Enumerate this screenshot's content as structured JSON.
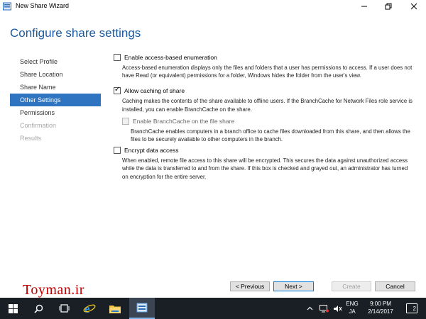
{
  "window": {
    "title": "New Share Wizard",
    "controls": {
      "minimize": "—",
      "maximize": "❐",
      "close": "✕"
    }
  },
  "page_title": "Configure share settings",
  "steps": [
    {
      "label": "Select Profile",
      "state": "normal"
    },
    {
      "label": "Share Location",
      "state": "normal"
    },
    {
      "label": "Share Name",
      "state": "normal"
    },
    {
      "label": "Other Settings",
      "state": "active"
    },
    {
      "label": "Permissions",
      "state": "normal"
    },
    {
      "label": "Confirmation",
      "state": "disabled"
    },
    {
      "label": "Results",
      "state": "disabled"
    }
  ],
  "options": {
    "abe": {
      "label": "Enable access-based enumeration",
      "checked": false,
      "description": "Access-based enumeration displays only the files and folders that a user has permissions to access. If a user does not have Read (or equivalent) permissions for a folder, Windows hides the folder from the user's view."
    },
    "caching": {
      "label": "Allow caching of share",
      "checked": true,
      "description": "Caching makes the contents of the share available to offline users. If the BranchCache for Network Files role service is installed, you can enable BranchCache on the share."
    },
    "branchcache": {
      "label": "Enable BranchCache on the file share",
      "checked": false,
      "disabled": true,
      "description": "BranchCache enables computers in a branch office to cache files downloaded from this share, and then allows the files to be securely available to other computers in the branch."
    },
    "encrypt": {
      "label": "Encrypt data access",
      "checked": false,
      "description": "When enabled, remote file access to this share will be encrypted. This secures the data against unauthorized access while the data is transferred to and from the share. If this box is checked and grayed out, an administrator has turned on encryption for the entire server."
    }
  },
  "buttons": {
    "previous": "< Previous",
    "next": "Next >",
    "create": "Create",
    "cancel": "Cancel"
  },
  "watermark": "Toyman.ir",
  "taskbar": {
    "language_top": "ENG",
    "language_bottom": "JA",
    "time": "9:00 PM",
    "date": "2/14/2017",
    "notifications": "2"
  },
  "colors": {
    "accent": "#2f74c0",
    "heading": "#1a5aa0",
    "taskbar": "#1a1f26",
    "watermark": "#c00000"
  }
}
